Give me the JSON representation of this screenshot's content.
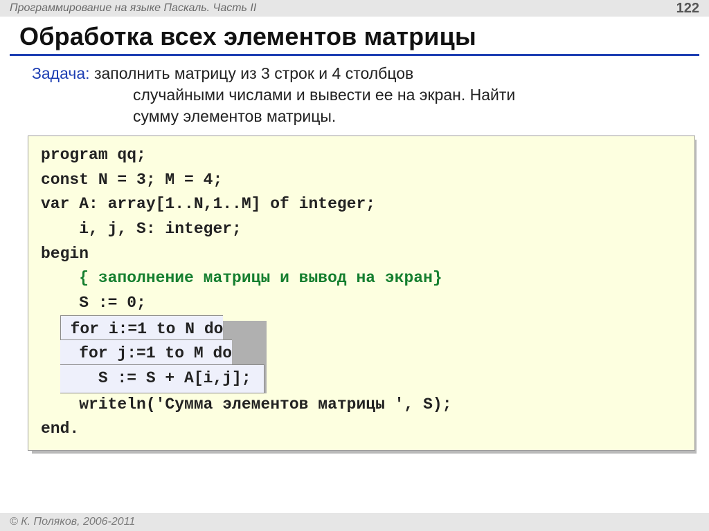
{
  "header": {
    "course": "Программирование на языке Паскаль. Часть II",
    "page": "122"
  },
  "title": "Обработка всех элементов матрицы",
  "task": {
    "label": "Задача:",
    "line1": " заполнить матрицу из 3 строк и 4 столбцов",
    "line2": "случайными числами и вывести ее на экран. Найти",
    "line3": "сумму элементов матрицы."
  },
  "code": {
    "l1": "program qq;",
    "l2": "const N = 3; M = 4;",
    "l3": "var A: array[1..N,1..M] of integer;",
    "l4": "    i, j, S: integer;",
    "l5": "begin",
    "comment_indent": "    ",
    "comment": "{ заполнение матрицы и вывод на экран}",
    "l7": "    S := 0;",
    "inner": {
      "r1": "for i:=1 to N do",
      "r2": "  for j:=1 to M do",
      "r3": "    S := S + A[i,j];"
    },
    "l9": "    writeln('Сумма элементов матрицы ', S);",
    "l10": "end."
  },
  "footer": "© К. Поляков, 2006-2011"
}
